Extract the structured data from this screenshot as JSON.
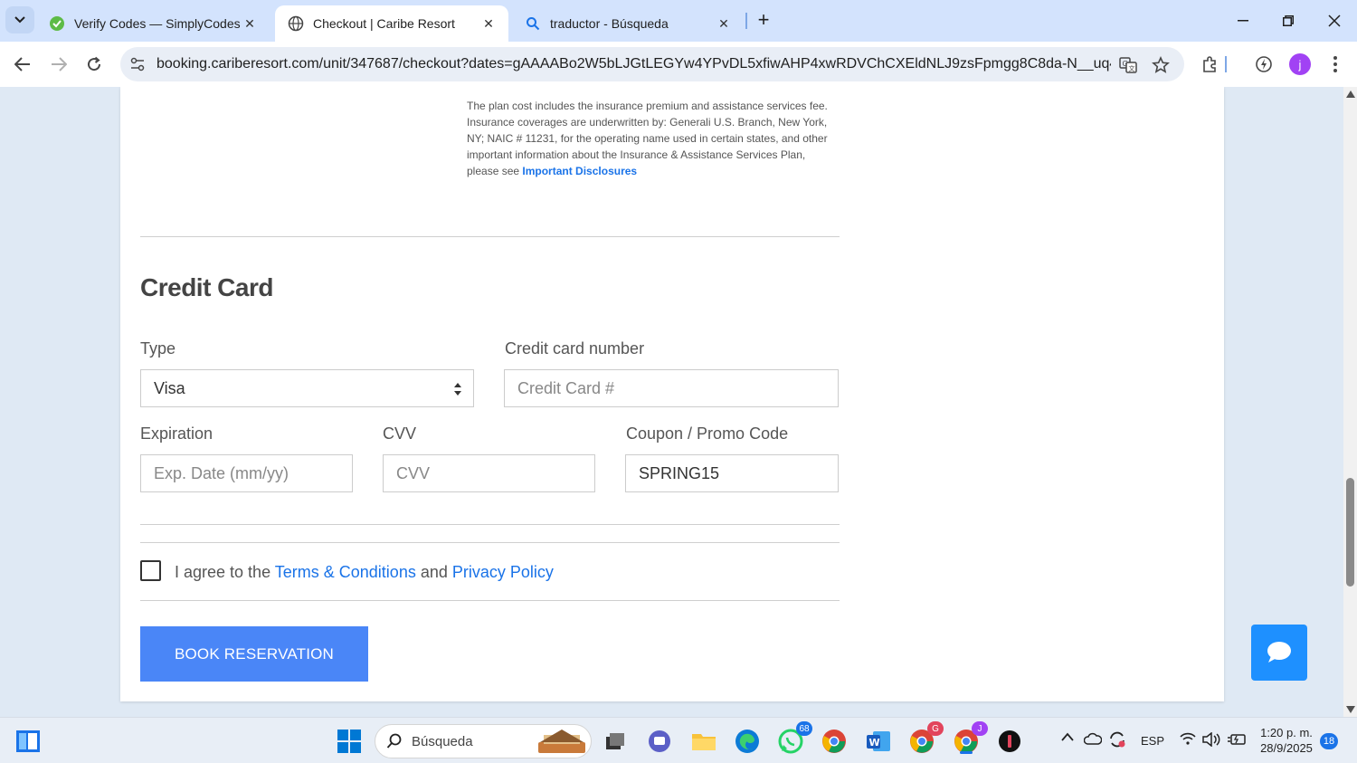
{
  "browser": {
    "tabs": [
      {
        "title": "Verify Codes — SimplyCodes",
        "icon": "simplycodes-icon",
        "active": false
      },
      {
        "title": "Checkout | Caribe Resort",
        "icon": "globe-icon",
        "active": true
      },
      {
        "title": "traductor - Búsqueda",
        "icon": "search-icon",
        "active": false
      }
    ],
    "new_tab": "+",
    "url": "booking.cariberesort.com/unit/347687/checkout?dates=gAAAABo2W5bLJGtLEGYw4YPvDL5xfiwAHP4xwRDVChCXEldNLJ9zsFpmgg8C8da-N__uq43LzKV...",
    "profile_initial": "j"
  },
  "disclosure": {
    "text": "The plan cost includes the insurance premium and assistance services fee. Insurance coverages are underwritten by: Generali U.S. Branch, New York, NY; NAIC # 11231, for the operating name used in certain states, and other important information about the Insurance & Assistance Services Plan, please see ",
    "link": "Important Disclosures"
  },
  "credit_card": {
    "heading": "Credit Card",
    "type_label": "Type",
    "type_value": "Visa",
    "number_label": "Credit card number",
    "number_placeholder": "Credit Card #",
    "exp_label": "Expiration",
    "exp_placeholder": "Exp. Date (mm/yy)",
    "cvv_label": "CVV",
    "cvv_placeholder": "CVV",
    "coupon_label": "Coupon / Promo Code",
    "coupon_value": "SPRING15"
  },
  "agreement": {
    "prefix": "I agree to the ",
    "terms": "Terms & Conditions",
    "middle": " and ",
    "privacy": "Privacy Policy"
  },
  "book_button": "BOOK RESERVATION",
  "taskbar": {
    "search_placeholder": "Búsqueda",
    "whatsapp_badge": "68",
    "chrome_g_badge": "G",
    "chrome_j_badge": "J",
    "language": "ESP",
    "time": "1:20 p. m.",
    "date": "28/9/2025",
    "notifications": "18"
  },
  "colors": {
    "accent": "#1a73e8",
    "button": "#4a86f7",
    "chat": "#1e90ff",
    "tabstrip": "#d3e3fd"
  }
}
